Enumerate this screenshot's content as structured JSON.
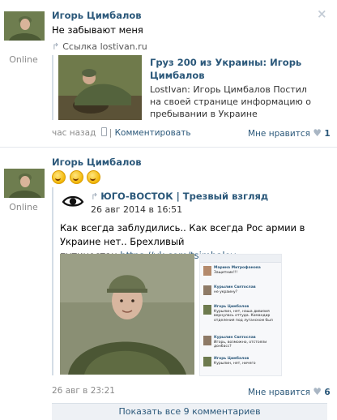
{
  "posts": [
    {
      "author": "Игорь Цимбалов",
      "status": "Online",
      "text": "Не забывают меня",
      "close_icon": "×",
      "link_prefix": "Ссылка",
      "link_domain": "lostivan.ru",
      "snippet": {
        "title": "Груз 200 из Украины: Игорь Цимбалов",
        "description": "LostIvan: Игорь Цимбалов Постил на своей странице информацию о пребывании в Украине"
      },
      "time": "час назад",
      "comment_label": "Комментировать",
      "like_label": "Мне нравится",
      "like_count": "1"
    },
    {
      "author": "Игорь Цимбалов",
      "status": "Online",
      "emoji_count": 3,
      "repost": {
        "source": "ЮГО-ВОСТОК | Трезвый взгляд",
        "date": "26 авг 2014 в 16:51",
        "text": "Как всегда заблудились.. Как всегда Рос армии в Украине нет.. Брехливый путиностан.",
        "link": "https://vk.com/tsimbalov"
      },
      "screenshot_comments": [
        {
          "name": "Марина Митрофанова",
          "text": "Защитник!!!"
        },
        {
          "name": "Курылин Святослав",
          "text": "не украину?"
        },
        {
          "name": "Игорь Цимбалов",
          "text": "Курылин, нет, наша дивизия вернулась оттуда. Командир отделения под луганском был"
        },
        {
          "name": "Курылин Святослав",
          "text": "Игорь, возможно, отстояли донбасс?"
        },
        {
          "name": "Игорь Цимбалов",
          "text": "Курылин, нет, ничего"
        }
      ],
      "time": "26 авг в 23:21",
      "like_label": "Мне нравится",
      "like_count": "6"
    }
  ],
  "show_comments_label": "Показать все 9 комментариев",
  "colors": {
    "link": "#2b587a",
    "meta": "#8a8a8a",
    "divider": "#e4e8ed"
  },
  "icons": {
    "close": "close-icon",
    "link": "link-arrow-icon",
    "phone": "mobile-icon",
    "heart": "heart-icon",
    "repost": "repost-arrow-icon",
    "eye_logo": "eye-logo-icon"
  }
}
